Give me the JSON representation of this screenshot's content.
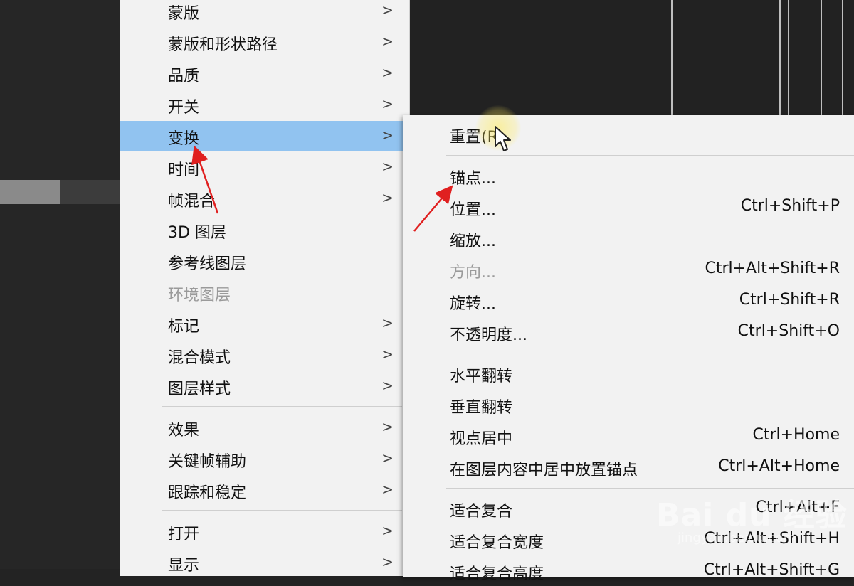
{
  "main_menu": {
    "items": [
      {
        "label": "蒙版",
        "submenu": true
      },
      {
        "label": "蒙版和形状路径",
        "submenu": true
      },
      {
        "label": "品质",
        "submenu": true
      },
      {
        "label": "开关",
        "submenu": true
      },
      {
        "label": "变换",
        "submenu": true,
        "highlighted": true
      },
      {
        "label": "时间",
        "submenu": true
      },
      {
        "label": "帧混合",
        "submenu": true
      },
      {
        "label": "3D 图层",
        "submenu": false
      },
      {
        "label": "参考线图层",
        "submenu": false
      },
      {
        "label": "环境图层",
        "submenu": false,
        "disabled": true
      },
      {
        "label": "标记",
        "submenu": true
      },
      {
        "label": "混合模式",
        "submenu": true
      },
      {
        "label": "图层样式",
        "submenu": true
      },
      {
        "label": "效果",
        "submenu": true
      },
      {
        "label": "关键帧辅助",
        "submenu": true
      },
      {
        "label": "跟踪和稳定",
        "submenu": true
      },
      {
        "label": "打开",
        "submenu": true
      },
      {
        "label": "显示",
        "submenu": true
      }
    ]
  },
  "transform_submenu": {
    "items": [
      {
        "label": "重置(R)",
        "shortcut": ""
      },
      {
        "label": "锚点...",
        "shortcut": ""
      },
      {
        "label": "位置...",
        "shortcut": "Ctrl+Shift+P"
      },
      {
        "label": "缩放...",
        "shortcut": ""
      },
      {
        "label": "方向...",
        "shortcut": "Ctrl+Alt+Shift+R",
        "disabled": true
      },
      {
        "label": "旋转...",
        "shortcut": "Ctrl+Shift+R"
      },
      {
        "label": "不透明度...",
        "shortcut": "Ctrl+Shift+O"
      },
      {
        "label": "水平翻转",
        "shortcut": ""
      },
      {
        "label": "垂直翻转",
        "shortcut": ""
      },
      {
        "label": "视点居中",
        "shortcut": "Ctrl+Home"
      },
      {
        "label": "在图层内容中居中放置锚点",
        "shortcut": "Ctrl+Alt+Home"
      },
      {
        "label": "适合复合",
        "shortcut": "Ctrl+Alt+F"
      },
      {
        "label": "适合复合宽度",
        "shortcut": "Ctrl+Alt+Shift+H"
      },
      {
        "label": "适合复合高度",
        "shortcut": "Ctrl+Alt+Shift+G"
      }
    ]
  },
  "chevron_glyph": ">",
  "watermark": {
    "brand": "Bai du 经验",
    "url": "jingyan.baidu.com"
  },
  "colors": {
    "highlight": "#91c3f0",
    "menu_bg": "#f2f2f2",
    "arrow": "#e02020",
    "background": "#232323"
  }
}
